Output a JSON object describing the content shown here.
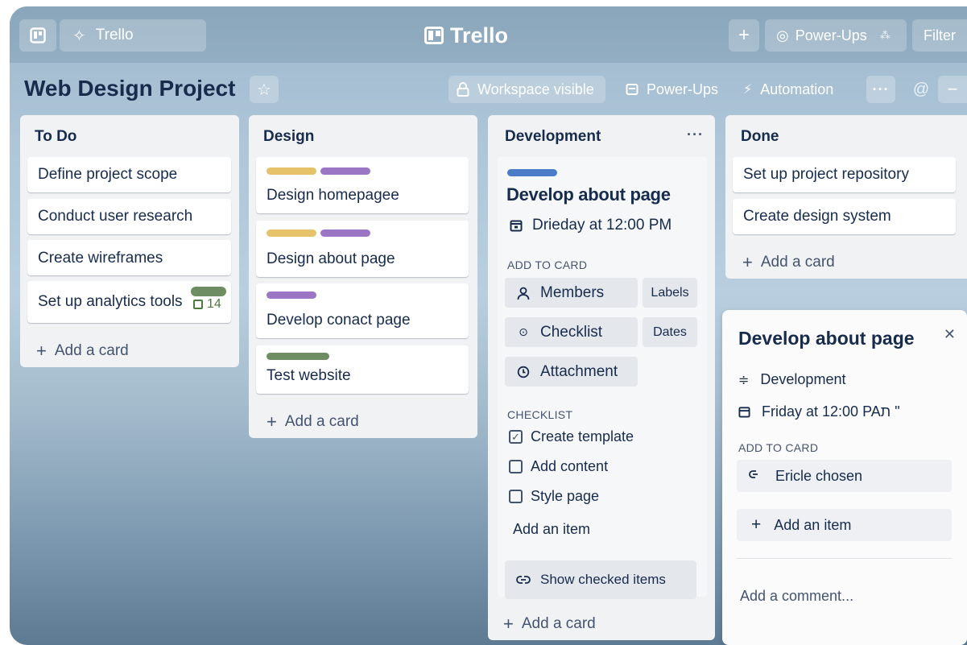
{
  "topbar": {
    "home_label": "Trello",
    "logo_text": "Trello",
    "power_ups_label": "Power-Ups",
    "filter_label": "Filter"
  },
  "board": {
    "title": "Web Design Project",
    "visibility_label": "Workspace visible",
    "power_ups_label": "Power-Ups",
    "automation_label": "Automation"
  },
  "lists": {
    "todo": {
      "title": "To Do",
      "cards": [
        "Define project scope",
        "Conduct user research",
        "Create wireframes",
        "Set up analytics tools"
      ],
      "badge_count": "14",
      "add_label": "Add a card"
    },
    "design": {
      "title": "Design",
      "cards": [
        "Design homepagee",
        "Design about page",
        "Develop conact page",
        "Test website"
      ],
      "add_label": "Add a card"
    },
    "development": {
      "title": "Development",
      "card_title": "Develop about page",
      "due": "Drieday at 12:00 PM",
      "add_to_card_heading": "ADD TO CARD",
      "members_label": "Members",
      "labels_label": "Labels",
      "checklist_label": "Checklist",
      "dates_label": "Dates",
      "attachment_label": "Attachment",
      "checklist_heading": "CHECKLIST",
      "checklist_items": [
        {
          "text": "Create template",
          "checked": true
        },
        {
          "text": "Add content",
          "checked": false
        },
        {
          "text": "Style page",
          "checked": false
        }
      ],
      "add_item_label": "Add an item",
      "show_checked_label": "Show checked items",
      "add_label": "Add a card"
    },
    "done": {
      "title": "Done",
      "cards": [
        "Set up project repository",
        "Create design system"
      ],
      "add_label": "Add a card"
    }
  },
  "panel": {
    "title": "Develop about page",
    "list_name": "Development",
    "due": "Friday at 12:00 PAת \"",
    "add_to_card_heading": "ADD TO CARD",
    "chosen_label": "Ericle chosen",
    "add_item_label": "Add an item",
    "comment_placeholder": "Add a comment..."
  },
  "colors": {
    "label_yellow": "#e6c36a",
    "label_purple": "#9a76c4",
    "label_green": "#6f8d62",
    "label_blue": "#4a7cc7"
  }
}
